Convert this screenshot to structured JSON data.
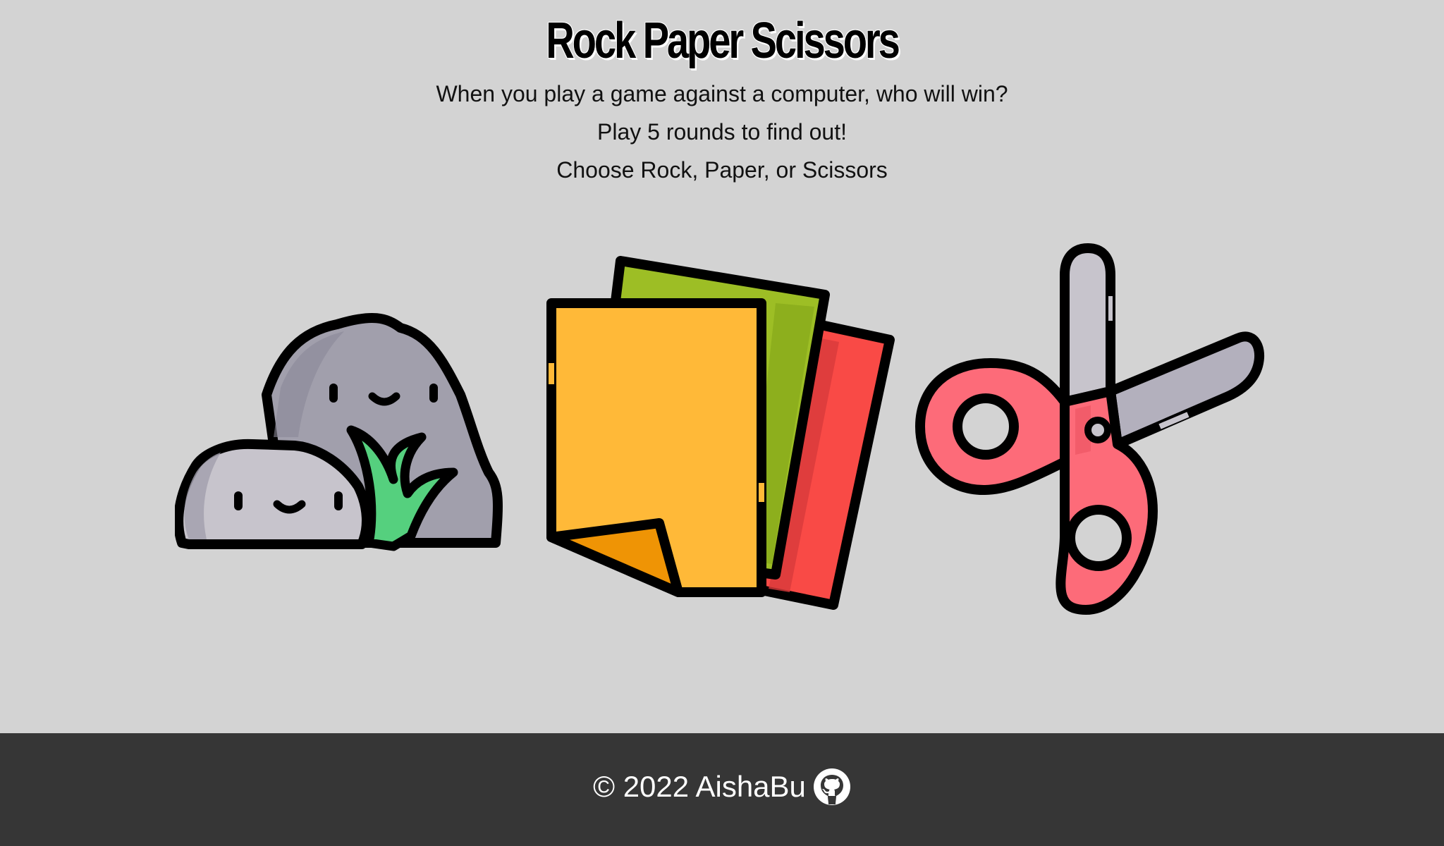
{
  "header": {
    "title": "Rock Paper Scissors",
    "intro": "When you play a game against a computer, who will win?",
    "rounds": "Play 5 rounds to find out!",
    "prompt": "Choose Rock, Paper, or Scissors"
  },
  "choices": [
    {
      "id": "rock",
      "icon": "rock-icon",
      "title": "Rock"
    },
    {
      "id": "paper",
      "icon": "paper-icon",
      "title": "Paper"
    },
    {
      "id": "scissors",
      "icon": "scissors-icon",
      "title": "Scissors"
    }
  ],
  "footer": {
    "copyright": "© 2022 AishaBu",
    "link_icon": "github-icon"
  },
  "colors": {
    "background": "#d3d3d3",
    "footer": "#363636",
    "rock_big": "#a19fac",
    "rock_small": "#c7c4cc",
    "grass": "#55d07e",
    "paper_yellow": "#ffb938",
    "paper_green": "#9dbe25",
    "paper_red": "#f94a46",
    "scissors_red": "#fd6b79",
    "scissors_blade": "#c7c4cc"
  }
}
